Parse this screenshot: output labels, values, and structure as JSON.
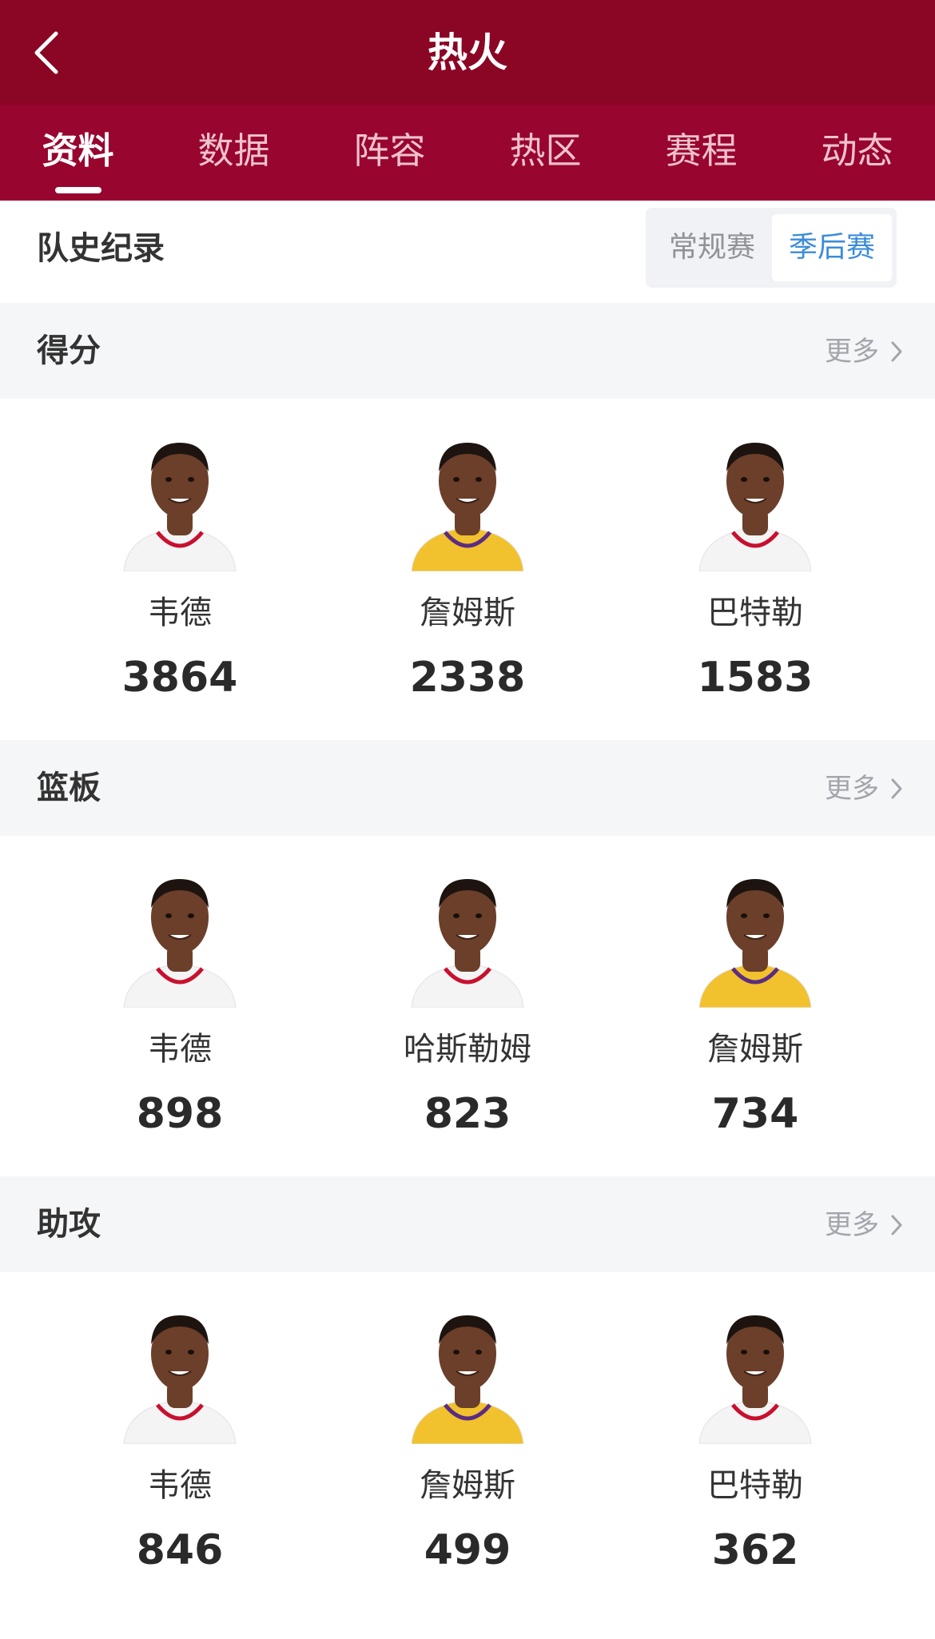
{
  "header": {
    "title": "热火"
  },
  "tabs": [
    {
      "label": "资料",
      "active": true
    },
    {
      "label": "数据",
      "active": false
    },
    {
      "label": "阵容",
      "active": false
    },
    {
      "label": "热区",
      "active": false
    },
    {
      "label": "赛程",
      "active": false
    },
    {
      "label": "动态",
      "active": false
    }
  ],
  "records": {
    "title": "队史纪录",
    "toggle": {
      "regular": "常规赛",
      "playoff": "季后赛",
      "selected": "季后赛"
    }
  },
  "sections": [
    {
      "title": "得分",
      "more": "更多",
      "players": [
        {
          "name": "韦德",
          "value": "3864",
          "jersey": "white"
        },
        {
          "name": "詹姆斯",
          "value": "2338",
          "jersey": "gold"
        },
        {
          "name": "巴特勒",
          "value": "1583",
          "jersey": "white"
        }
      ]
    },
    {
      "title": "篮板",
      "more": "更多",
      "players": [
        {
          "name": "韦德",
          "value": "898",
          "jersey": "white"
        },
        {
          "name": "哈斯勒姆",
          "value": "823",
          "jersey": "white"
        },
        {
          "name": "詹姆斯",
          "value": "734",
          "jersey": "gold"
        }
      ]
    },
    {
      "title": "助攻",
      "more": "更多",
      "players": [
        {
          "name": "韦德",
          "value": "846",
          "jersey": "white"
        },
        {
          "name": "詹姆斯",
          "value": "499",
          "jersey": "gold"
        },
        {
          "name": "巴特勒",
          "value": "362",
          "jersey": "white"
        }
      ]
    }
  ],
  "colors": {
    "header_bg": "#8b0524",
    "tab_bg": "#98052e",
    "accent_blue": "#3b8cd9",
    "section_bg": "#f5f6f8",
    "jersey_gold": "#f2c12e",
    "jersey_white": "#f4f4f4",
    "skin": "#6b3f2a"
  }
}
